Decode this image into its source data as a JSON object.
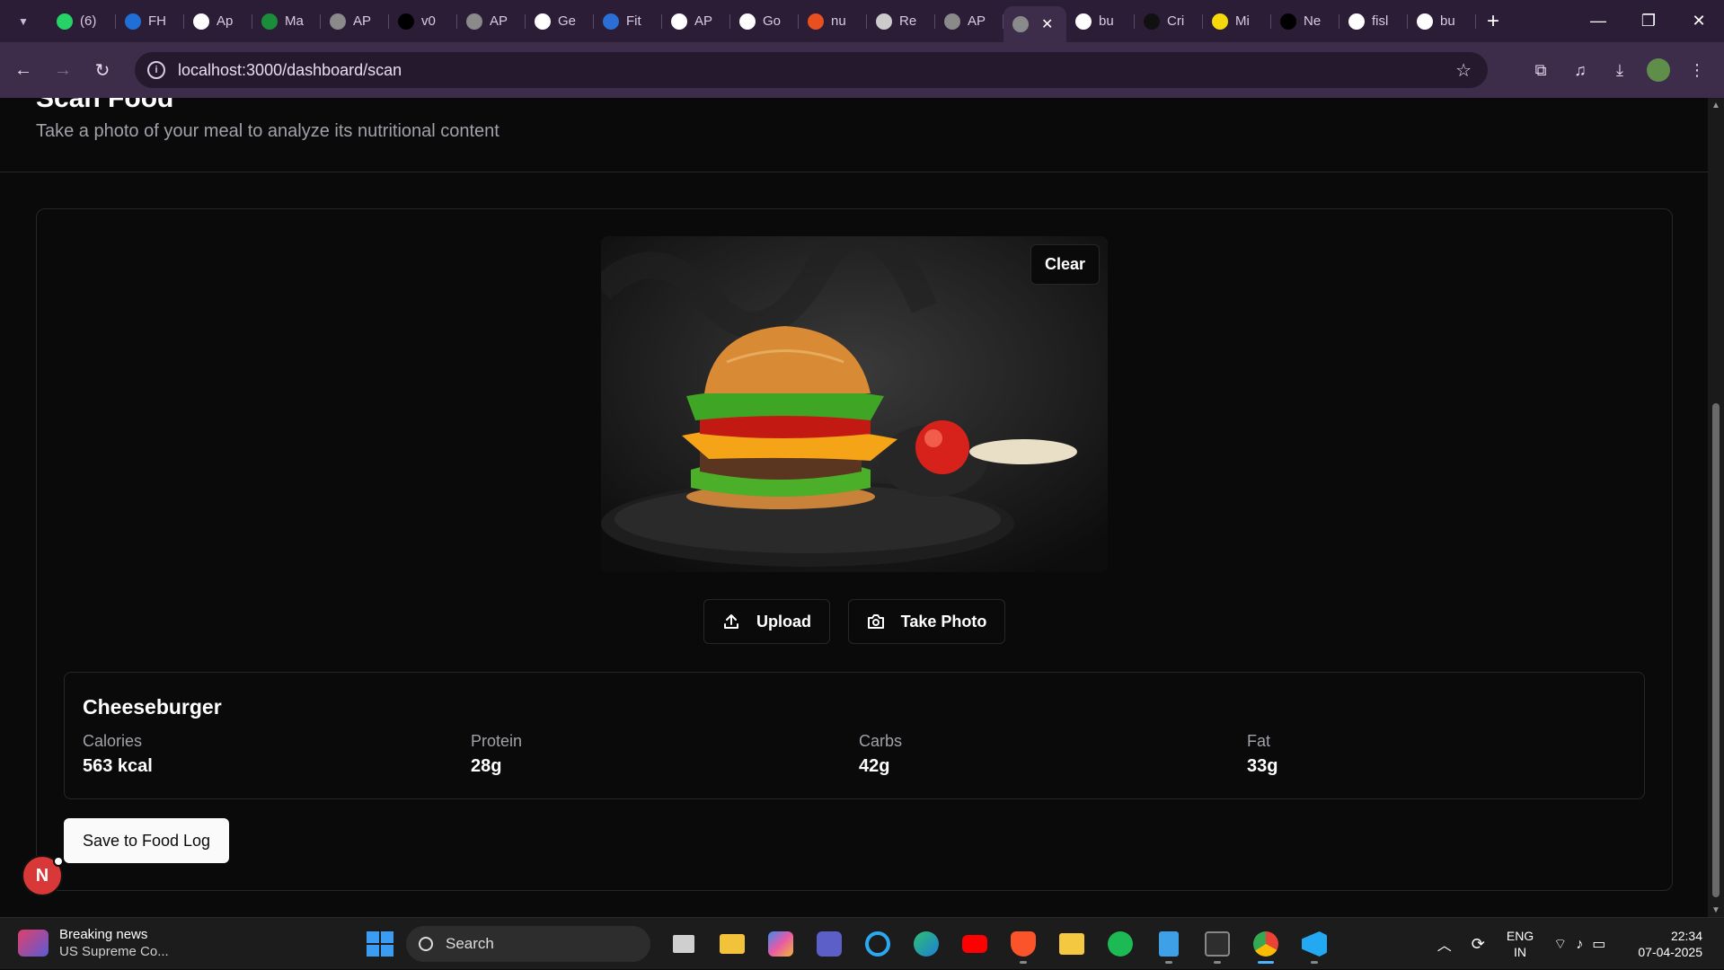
{
  "browser": {
    "tabs": [
      {
        "label": "(6)",
        "color": "#25d366"
      },
      {
        "label": "FH",
        "color": "#1f6fd6"
      },
      {
        "label": "Ap",
        "color": "#ffffff"
      },
      {
        "label": "Ma",
        "color": "#1a8c3a"
      },
      {
        "label": "AP",
        "color": "#8a8a8a"
      },
      {
        "label": "v0",
        "color": "#000000"
      },
      {
        "label": "AP",
        "color": "#8a8a8a"
      },
      {
        "label": "Ge",
        "color": "#ffffff"
      },
      {
        "label": "Fit",
        "color": "#2b6fd6"
      },
      {
        "label": "AP",
        "color": "#ffffff"
      },
      {
        "label": "Go",
        "color": "#ffffff"
      },
      {
        "label": "nu",
        "color": "#e8501f"
      },
      {
        "label": "Re",
        "color": "#cccccc"
      },
      {
        "label": "AP",
        "color": "#8a8a8a"
      },
      {
        "label": "bu",
        "color": "#ffffff"
      },
      {
        "label": "Cri",
        "color": "#111111"
      },
      {
        "label": "Mi",
        "color": "#f5d90a"
      },
      {
        "label": "Ne",
        "color": "#000000"
      },
      {
        "label": "fisl",
        "color": "#ffffff"
      },
      {
        "label": "bu",
        "color": "#ffffff"
      }
    ],
    "url": "localhost:3000/dashboard/scan"
  },
  "page": {
    "title": "Scan Food",
    "subtitle": "Take a photo of your meal to analyze its nutritional content",
    "clear_label": "Clear",
    "upload_label": "Upload",
    "take_photo_label": "Take Photo",
    "save_label": "Save to Food Log",
    "avatar_initial": "N"
  },
  "result": {
    "food_name": "Cheeseburger",
    "stats": [
      {
        "label": "Calories",
        "value": "563 kcal"
      },
      {
        "label": "Protein",
        "value": "28g"
      },
      {
        "label": "Carbs",
        "value": "42g"
      },
      {
        "label": "Fat",
        "value": "33g"
      }
    ]
  },
  "taskbar": {
    "news_title": "Breaking news",
    "news_sub": "US Supreme Co...",
    "search_placeholder": "Search",
    "lang_1": "ENG",
    "lang_2": "IN",
    "time": "22:34",
    "date": "07-04-2025"
  }
}
